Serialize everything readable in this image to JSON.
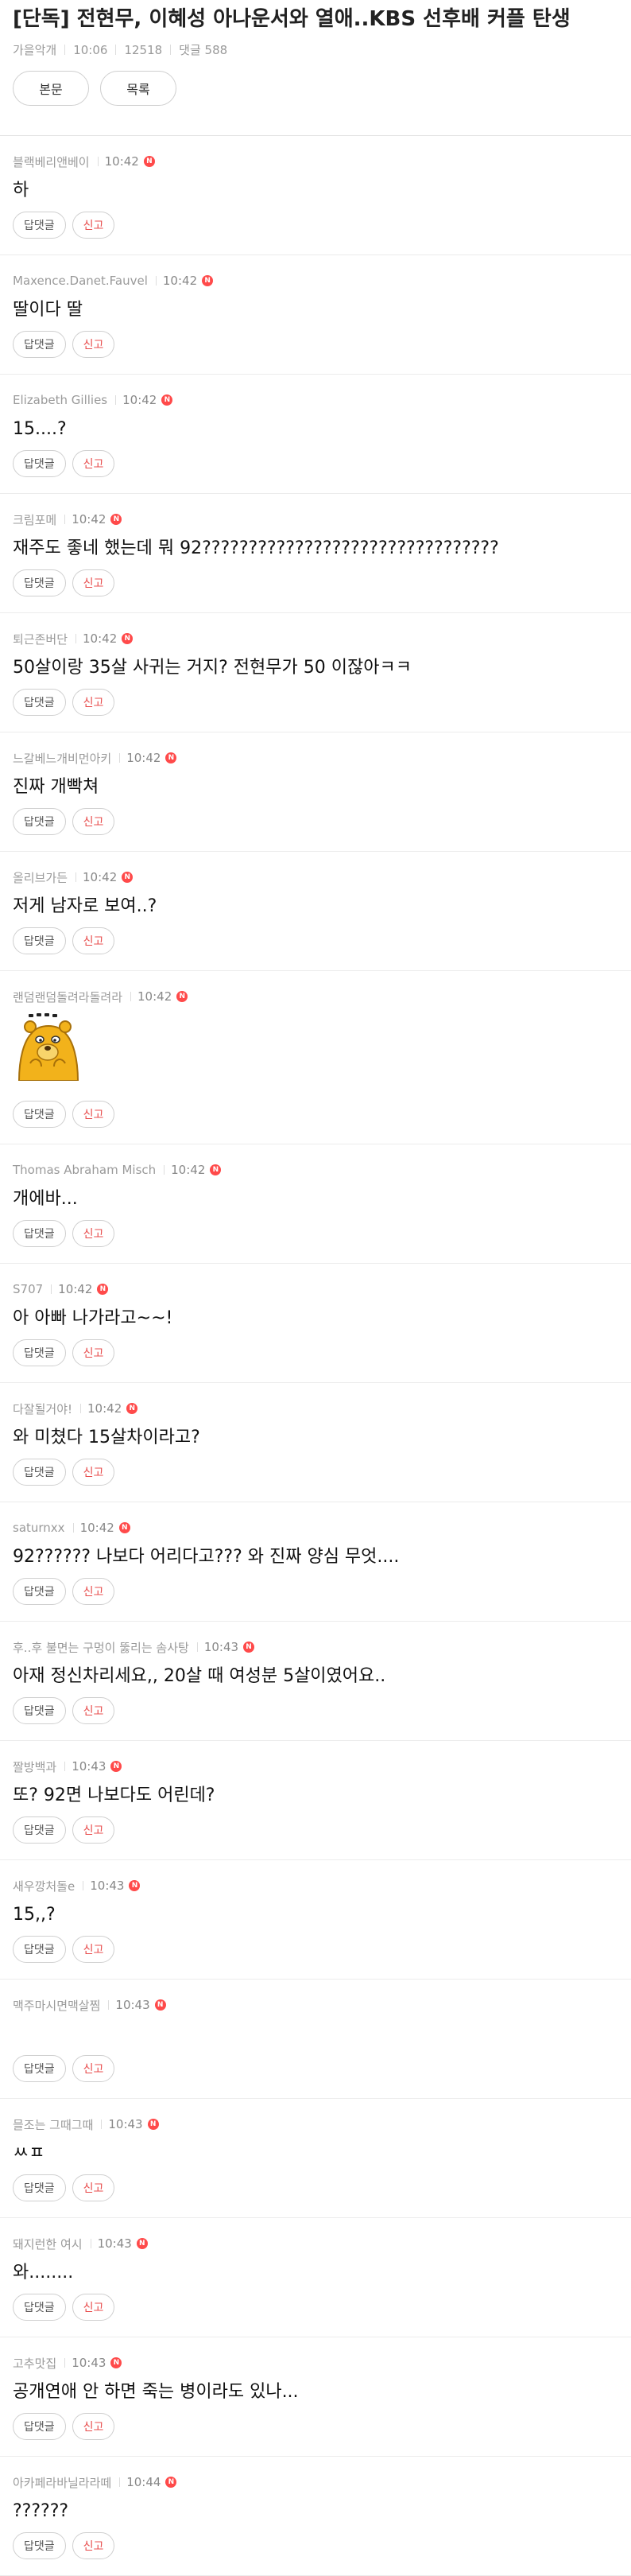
{
  "article": {
    "title": "[단독] 전현무, 이혜성 아나운서와 열애..KBS 선후배 커플 탄생",
    "author": "가을악개",
    "time": "10:06",
    "views": "12518",
    "comment_count_label": "댓글 588"
  },
  "tabs": {
    "body_label": "본문",
    "list_label": "목록"
  },
  "actions": {
    "reply_label": "답댓글",
    "report_label": "신고",
    "new_badge": "N"
  },
  "comments": [
    {
      "author": "블랙베리앤베이",
      "time": "10:42",
      "text": "하",
      "sticker": false
    },
    {
      "author": "Maxence.Danet.Fauvel",
      "time": "10:42",
      "text": "딸이다 딸",
      "sticker": false
    },
    {
      "author": "Elizabeth Gillies",
      "time": "10:42",
      "text": "15....?",
      "sticker": false
    },
    {
      "author": "크림포메",
      "time": "10:42",
      "text": "재주도 좋네 했는데 뭐 92????????????????????????????????",
      "sticker": false
    },
    {
      "author": "퇴근존버단",
      "time": "10:42",
      "text": "50살이랑 35살 사귀는 거지? 전현무가 50 이잖아ㅋㅋ",
      "sticker": false
    },
    {
      "author": "느갈베느개비먼아키",
      "time": "10:42",
      "text": "진짜 개빡쳐",
      "sticker": false
    },
    {
      "author": "올리브가든",
      "time": "10:42",
      "text": "저게 남자로 보여..?",
      "sticker": false
    },
    {
      "author": "랜덤랜덤돌려라돌려라",
      "time": "10:42",
      "text": "",
      "sticker": true
    },
    {
      "author": "Thomas Abraham Misch",
      "time": "10:42",
      "text": "개에바...",
      "sticker": false
    },
    {
      "author": "S707",
      "time": "10:42",
      "text": "아 아빠 나가라고~~!",
      "sticker": false
    },
    {
      "author": "다잘될거야!",
      "time": "10:42",
      "text": "와 미쳤다 15살차이라고?",
      "sticker": false
    },
    {
      "author": "saturnxx",
      "time": "10:42",
      "text": "92?????? 나보다 어리다고??? 와 진짜 양심 무엇....",
      "sticker": false
    },
    {
      "author": "후..후 불면는 구멍이 뚫리는 솜사탕",
      "time": "10:43",
      "text": "아재 정신차리세요,, 20살 때 여성분 5살이였어요..",
      "sticker": false
    },
    {
      "author": "짤방백과",
      "time": "10:43",
      "text": "또? 92면 나보다도 어린데?",
      "sticker": false
    },
    {
      "author": "새우깡처돌e",
      "time": "10:43",
      "text": "15,,?",
      "sticker": false
    },
    {
      "author": "맥주마시면맥살찜",
      "time": "10:43",
      "text": "",
      "sticker": false
    },
    {
      "author": "믈조는 그때그때",
      "time": "10:43",
      "text": "ㅆㅍ",
      "sticker": false
    },
    {
      "author": "돼지런한 여시",
      "time": "10:43",
      "text": "와........",
      "sticker": false
    },
    {
      "author": "고추맛집",
      "time": "10:43",
      "text": "공개연애 안 하면 죽는 병이라도 있나...",
      "sticker": false
    },
    {
      "author": "아카페라바닐라라떼",
      "time": "10:44",
      "text": "??????",
      "sticker": false
    }
  ]
}
